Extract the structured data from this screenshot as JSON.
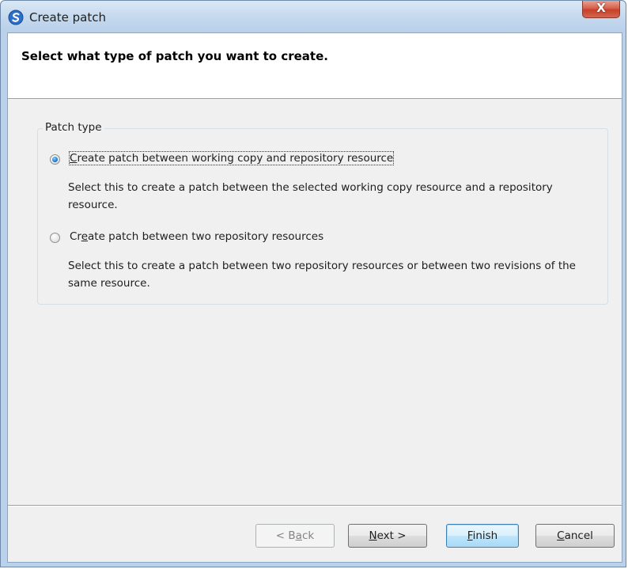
{
  "window": {
    "title": "Create patch",
    "close_label": "X"
  },
  "header": {
    "instruction": "Select what type of patch you want to create."
  },
  "patch_type": {
    "legend": "Patch type",
    "options": [
      {
        "label_pre": "",
        "label_mnemonic": "C",
        "label_post": "reate patch between working copy and repository resource",
        "description": "Select this to create a patch between the selected working copy resource and a repository resource.",
        "selected": true
      },
      {
        "label_pre": "Cr",
        "label_mnemonic": "e",
        "label_post": "ate patch between two repository resources",
        "description": "Select this to create a patch between two repository resources or between two revisions of the same resource.",
        "selected": false
      }
    ]
  },
  "buttons": {
    "back": {
      "pre": "< B",
      "mnemonic": "a",
      "post": "ck",
      "enabled": false
    },
    "next": {
      "pre": "",
      "mnemonic": "N",
      "post": "ext >",
      "enabled": true
    },
    "finish": {
      "pre": "",
      "mnemonic": "F",
      "post": "inish",
      "enabled": true,
      "default": true
    },
    "cancel": {
      "pre": "",
      "mnemonic": "C",
      "post": "ancel",
      "enabled": true
    }
  },
  "colors": {
    "accent": "#3c7fb1",
    "app_icon": "#2a6fc9"
  },
  "icons": {
    "app": "svn-app-icon",
    "close": "close-icon"
  }
}
